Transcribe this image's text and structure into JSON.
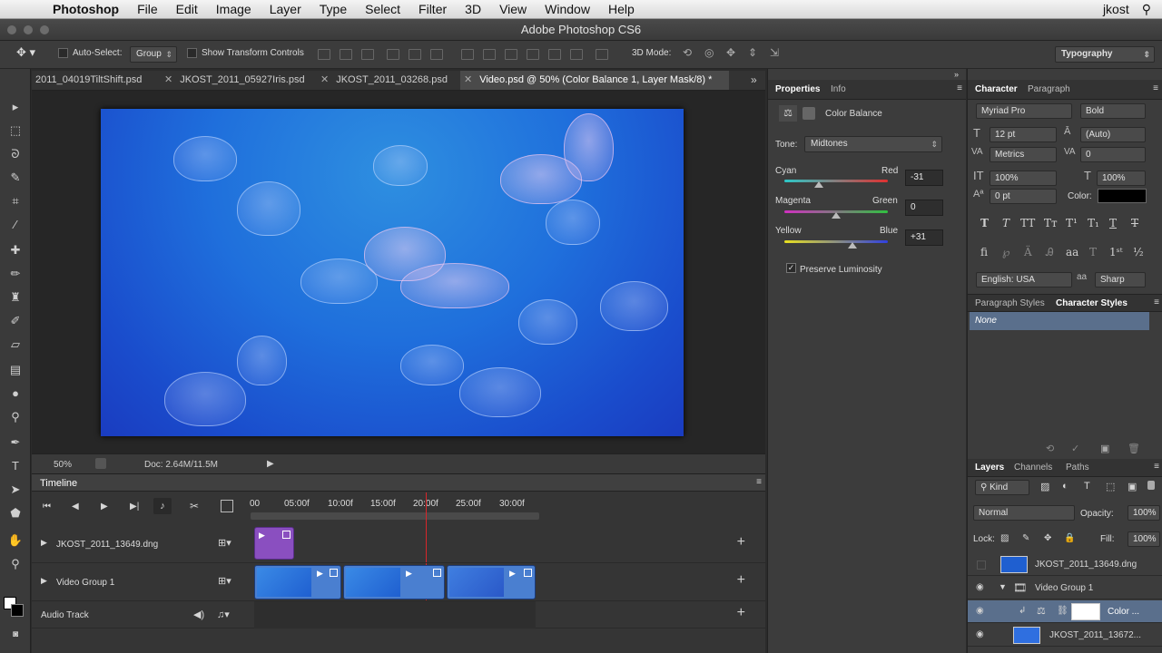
{
  "menubar": {
    "app": "Photoshop",
    "items": [
      "File",
      "Edit",
      "Image",
      "Layer",
      "Type",
      "Select",
      "Filter",
      "3D",
      "View",
      "Window",
      "Help"
    ],
    "user": "jkost"
  },
  "window_title": "Adobe Photoshop CS6",
  "options": {
    "auto_select_label": "Auto-Select:",
    "auto_select_value": "Group",
    "show_transform": "Show Transform Controls",
    "mode_3d": "3D Mode:",
    "workspace": "Typography"
  },
  "tabs": [
    {
      "label": "2011_04019TiltShift.psd"
    },
    {
      "label": "JKOST_2011_05927Iris.psd"
    },
    {
      "label": "JKOST_2011_03268.psd"
    },
    {
      "label": "Video.psd @ 50% (Color Balance 1, Layer Mask/8) *"
    }
  ],
  "status": {
    "zoom": "50%",
    "doc": "Doc: 2.64M/11.5M"
  },
  "timeline": {
    "title": "Timeline",
    "ticks": [
      "00",
      "05:00f",
      "10:00f",
      "15:00f",
      "20:00f",
      "25:00f",
      "30:00f"
    ],
    "tracks": [
      {
        "name": "JKOST_2011_13649.dng"
      },
      {
        "name": "Video Group 1"
      },
      {
        "name": "Audio Track"
      }
    ]
  },
  "properties": {
    "tab_properties": "Properties",
    "tab_info": "Info",
    "adjustment": "Color Balance",
    "tone_label": "Tone:",
    "tone_value": "Midtones",
    "sliders": [
      {
        "left": "Cyan",
        "right": "Red",
        "value": "-31"
      },
      {
        "left": "Magenta",
        "right": "Green",
        "value": "0"
      },
      {
        "left": "Yellow",
        "right": "Blue",
        "value": "+31"
      }
    ],
    "preserve": "Preserve Luminosity"
  },
  "character": {
    "tab_character": "Character",
    "tab_paragraph": "Paragraph",
    "font": "Myriad Pro",
    "style": "Bold",
    "size": "12 pt",
    "leading": "(Auto)",
    "kerning": "Metrics",
    "tracking": "0",
    "vscale": "100%",
    "hscale": "100%",
    "baseline": "0 pt",
    "color_label": "Color:",
    "language": "English: USA",
    "aa_label": "aa",
    "antialias": "Sharp",
    "tab_paragraph_styles": "Paragraph Styles",
    "tab_character_styles": "Character Styles",
    "style_item": "None"
  },
  "layers": {
    "tab_layers": "Layers",
    "tab_channels": "Channels",
    "tab_paths": "Paths",
    "kind": "Kind",
    "blend": "Normal",
    "opacity_label": "Opacity:",
    "opacity": "100%",
    "lock_label": "Lock:",
    "fill_label": "Fill:",
    "fill": "100%",
    "rows": [
      {
        "name": "JKOST_2011_13649.dng"
      },
      {
        "name": "Video Group 1"
      },
      {
        "name": "Color ..."
      },
      {
        "name": "JKOST_2011_13672..."
      }
    ]
  }
}
